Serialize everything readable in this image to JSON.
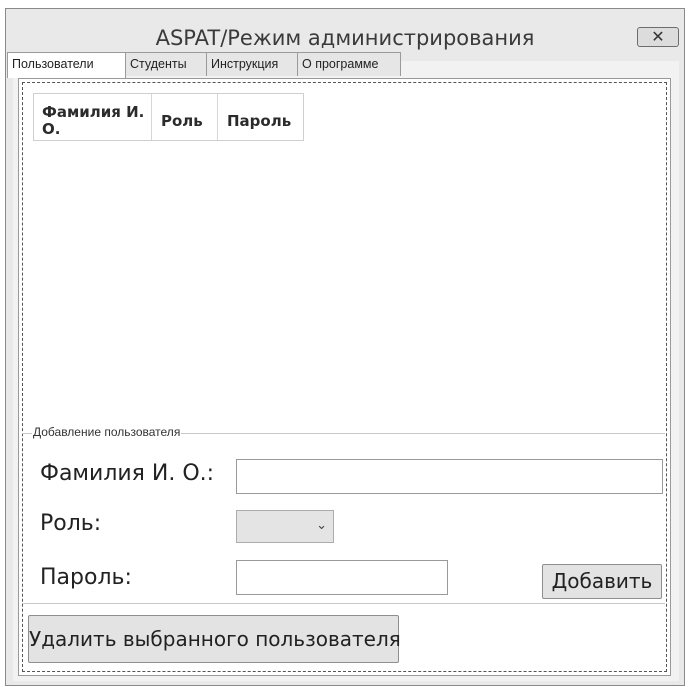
{
  "window": {
    "title": "ASPAT/Режим администрирования",
    "close_symbol": "✕"
  },
  "tabs": [
    {
      "label": "Пользователи",
      "active": true
    },
    {
      "label": "Студенты",
      "active": false
    },
    {
      "label": "Инструкция",
      "active": false
    },
    {
      "label": "О программе",
      "active": false
    }
  ],
  "users_table": {
    "columns": [
      "Фамилия И. О.",
      "Роль",
      "Пароль"
    ],
    "rows": []
  },
  "add_user": {
    "legend": "Добавление пользователя",
    "name_label": "Фамилия И. О.:",
    "name_value": "",
    "role_label": "Роль:",
    "role_value": "",
    "password_label": "Пароль:",
    "password_value": "",
    "add_button": "Добавить"
  },
  "delete_button": "Удалить выбранного пользователя"
}
